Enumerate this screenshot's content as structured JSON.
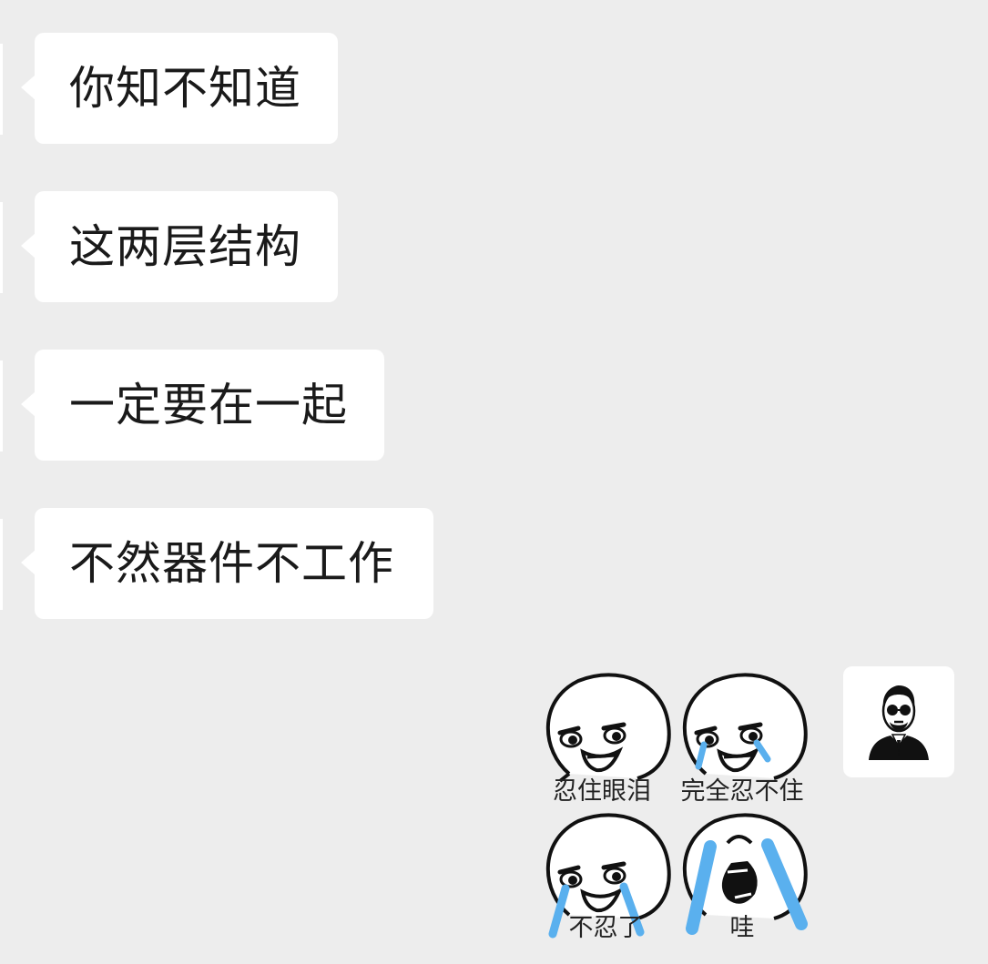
{
  "messages": [
    {
      "sender": "other",
      "text": "你知不知道"
    },
    {
      "sender": "other",
      "text": "这两层结构"
    },
    {
      "sender": "other",
      "text": "一定要在一起"
    },
    {
      "sender": "other",
      "text": "不然器件不工作"
    }
  ],
  "sticker": {
    "icon": "crying-face-sticker-icon",
    "captions": [
      "忍住眼泪",
      "完全忍不住",
      "不忍了",
      "哇"
    ],
    "tear_color": "#5ab0ee"
  },
  "self_avatar": {
    "icon": "man-with-sunglasses-avatar-icon"
  },
  "colors": {
    "background": "#ededed",
    "bubble": "#ffffff",
    "text": "#1a1a1a"
  }
}
